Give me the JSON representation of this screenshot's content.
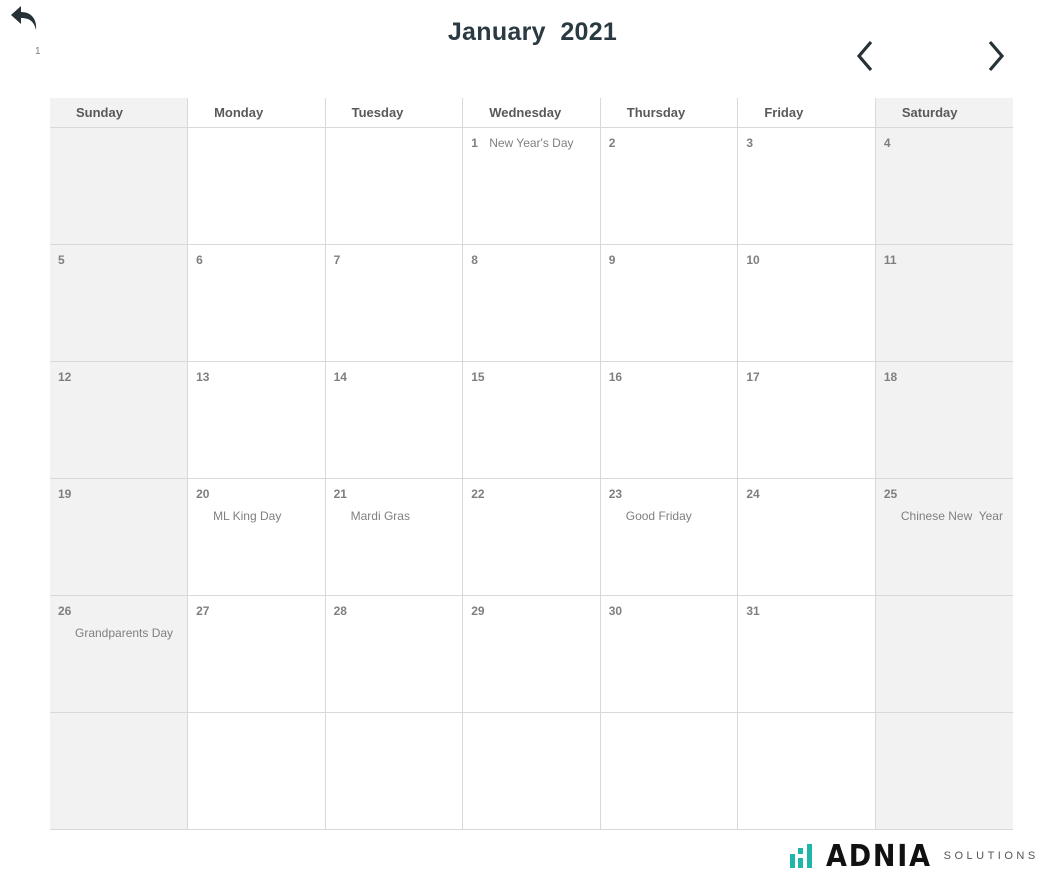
{
  "header": {
    "title": "January  2021",
    "sheet_number": "1",
    "back_icon": "undo-arrow-icon",
    "prev_icon": "chevron-left-icon",
    "next_icon": "chevron-right-icon"
  },
  "calendar": {
    "weekdays": [
      "Sunday",
      "Monday",
      "Tuesday",
      "Wednesday",
      "Thursday",
      "Friday",
      "Saturday"
    ],
    "weeks": [
      [
        {
          "day": "",
          "event": ""
        },
        {
          "day": "",
          "event": ""
        },
        {
          "day": "",
          "event": ""
        },
        {
          "day": "1",
          "event": "New Year's Day",
          "inline": true
        },
        {
          "day": "2",
          "event": ""
        },
        {
          "day": "3",
          "event": ""
        },
        {
          "day": "4",
          "event": ""
        }
      ],
      [
        {
          "day": "5",
          "event": ""
        },
        {
          "day": "6",
          "event": ""
        },
        {
          "day": "7",
          "event": ""
        },
        {
          "day": "8",
          "event": ""
        },
        {
          "day": "9",
          "event": ""
        },
        {
          "day": "10",
          "event": ""
        },
        {
          "day": "11",
          "event": ""
        }
      ],
      [
        {
          "day": "12",
          "event": ""
        },
        {
          "day": "13",
          "event": ""
        },
        {
          "day": "14",
          "event": ""
        },
        {
          "day": "15",
          "event": ""
        },
        {
          "day": "16",
          "event": ""
        },
        {
          "day": "17",
          "event": ""
        },
        {
          "day": "18",
          "event": ""
        }
      ],
      [
        {
          "day": "19",
          "event": ""
        },
        {
          "day": "20",
          "event": "ML King Day"
        },
        {
          "day": "21",
          "event": "Mardi Gras"
        },
        {
          "day": "22",
          "event": ""
        },
        {
          "day": "23",
          "event": "Good Friday"
        },
        {
          "day": "24",
          "event": ""
        },
        {
          "day": "25",
          "event": "Chinese New  Year"
        }
      ],
      [
        {
          "day": "26",
          "event": "Grandparents Day"
        },
        {
          "day": "27",
          "event": ""
        },
        {
          "day": "28",
          "event": ""
        },
        {
          "day": "29",
          "event": ""
        },
        {
          "day": "30",
          "event": ""
        },
        {
          "day": "31",
          "event": ""
        },
        {
          "day": "",
          "event": ""
        }
      ],
      [
        {
          "day": "",
          "event": ""
        },
        {
          "day": "",
          "event": ""
        },
        {
          "day": "",
          "event": ""
        },
        {
          "day": "",
          "event": ""
        },
        {
          "day": "",
          "event": ""
        },
        {
          "day": "",
          "event": ""
        },
        {
          "day": "",
          "event": ""
        }
      ]
    ]
  },
  "footer": {
    "logo_word": "ADNIA",
    "logo_sub": "SOLUTIONS",
    "logo_icon": "adnia-bars-logo-icon"
  },
  "colors": {
    "title": "#2b3a42",
    "weekend_bg": "#f2f2f2",
    "grid": "#d9d9d9",
    "text": "#7f7f7f",
    "logo_accent": "#1fb5a8"
  }
}
